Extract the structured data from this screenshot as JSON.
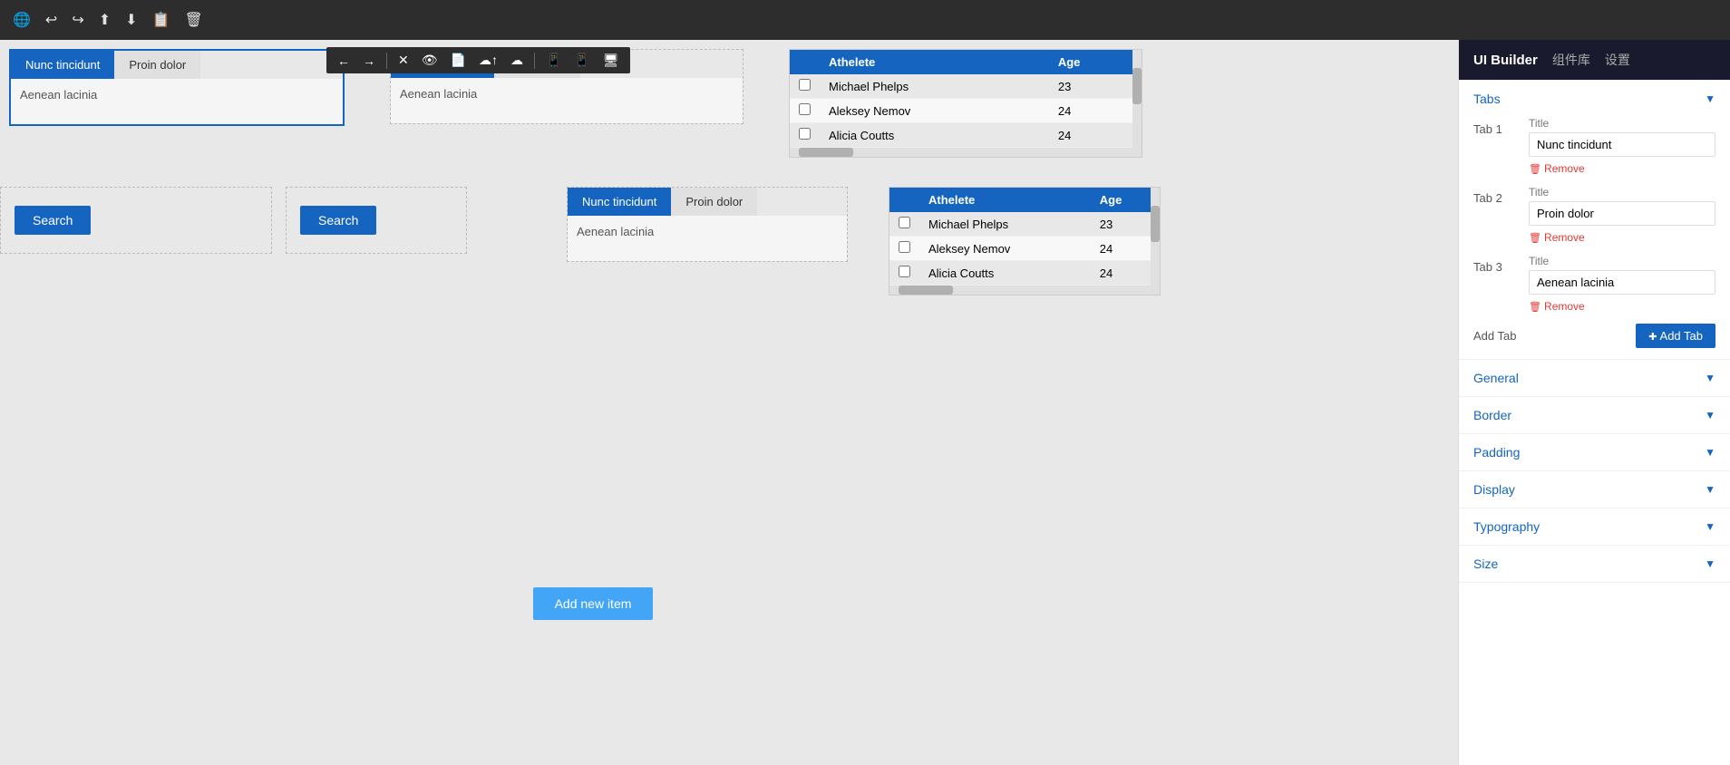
{
  "toolbar": {
    "title": "UI Builder",
    "nav_components": "组件库",
    "nav_settings": "设置"
  },
  "floating_toolbar": {
    "icons": [
      "←",
      "→",
      "✕",
      "👁",
      "📋",
      "☁",
      "☁",
      "📱",
      "📱",
      "🖥"
    ]
  },
  "canvas": {
    "tabs_widget_1": {
      "tabs": [
        {
          "label": "Nunc tincidunt",
          "active": true
        },
        {
          "label": "Proin dolor",
          "active": false
        },
        {
          "label": "Aenean lacinia",
          "active": false
        }
      ],
      "content": ""
    },
    "tabs_widget_2": {
      "tabs": [
        {
          "label": "Nunc tincidunt",
          "active": true
        },
        {
          "label": "Proin dolor",
          "active": false
        }
      ],
      "content": "Aenean lacinia"
    },
    "table_widget_1": {
      "columns": [
        "Athelete",
        "Age"
      ],
      "rows": [
        {
          "name": "Michael Phelps",
          "age": "23"
        },
        {
          "name": "Aleksey Nemov",
          "age": "24"
        },
        {
          "name": "Alicia Coutts",
          "age": "24"
        }
      ]
    },
    "search_btn_1": "Search",
    "search_btn_2": "Search",
    "tabs_widget_3": {
      "tabs": [
        {
          "label": "Nunc tincidunt",
          "active": true
        },
        {
          "label": "Proin dolor",
          "active": false
        }
      ],
      "content": "Aenean lacinia"
    },
    "table_widget_2": {
      "columns": [
        "Athelete",
        "Age"
      ],
      "rows": [
        {
          "name": "Michael Phelps",
          "age": "23"
        },
        {
          "name": "Aleksey Nemov",
          "age": "24"
        },
        {
          "name": "Alicia Coutts",
          "age": "24"
        }
      ]
    },
    "add_new_btn": "Add new item"
  },
  "right_panel": {
    "title": "UI Builder",
    "nav_components": "组件库",
    "nav_settings": "设置",
    "tabs_section_title": "Tabs",
    "tabs_section_expanded": true,
    "tab1": {
      "label": "Tab 1",
      "title_label": "Title",
      "value": "Nunc tincidunt",
      "remove_label": "Remove"
    },
    "tab2": {
      "label": "Tab 2",
      "title_label": "Title",
      "value": "Proin dolor",
      "remove_label": "Remove"
    },
    "tab3": {
      "label": "Tab 3",
      "title_label": "Title",
      "value": "Aenean lacinia",
      "remove_label": "Remove"
    },
    "add_tab_label": "Add Tab",
    "add_tab_btn": "Add Tab",
    "general_label": "General",
    "border_label": "Border",
    "padding_label": "Padding",
    "display_label": "Display",
    "typography_label": "Typography",
    "size_label": "Size"
  }
}
